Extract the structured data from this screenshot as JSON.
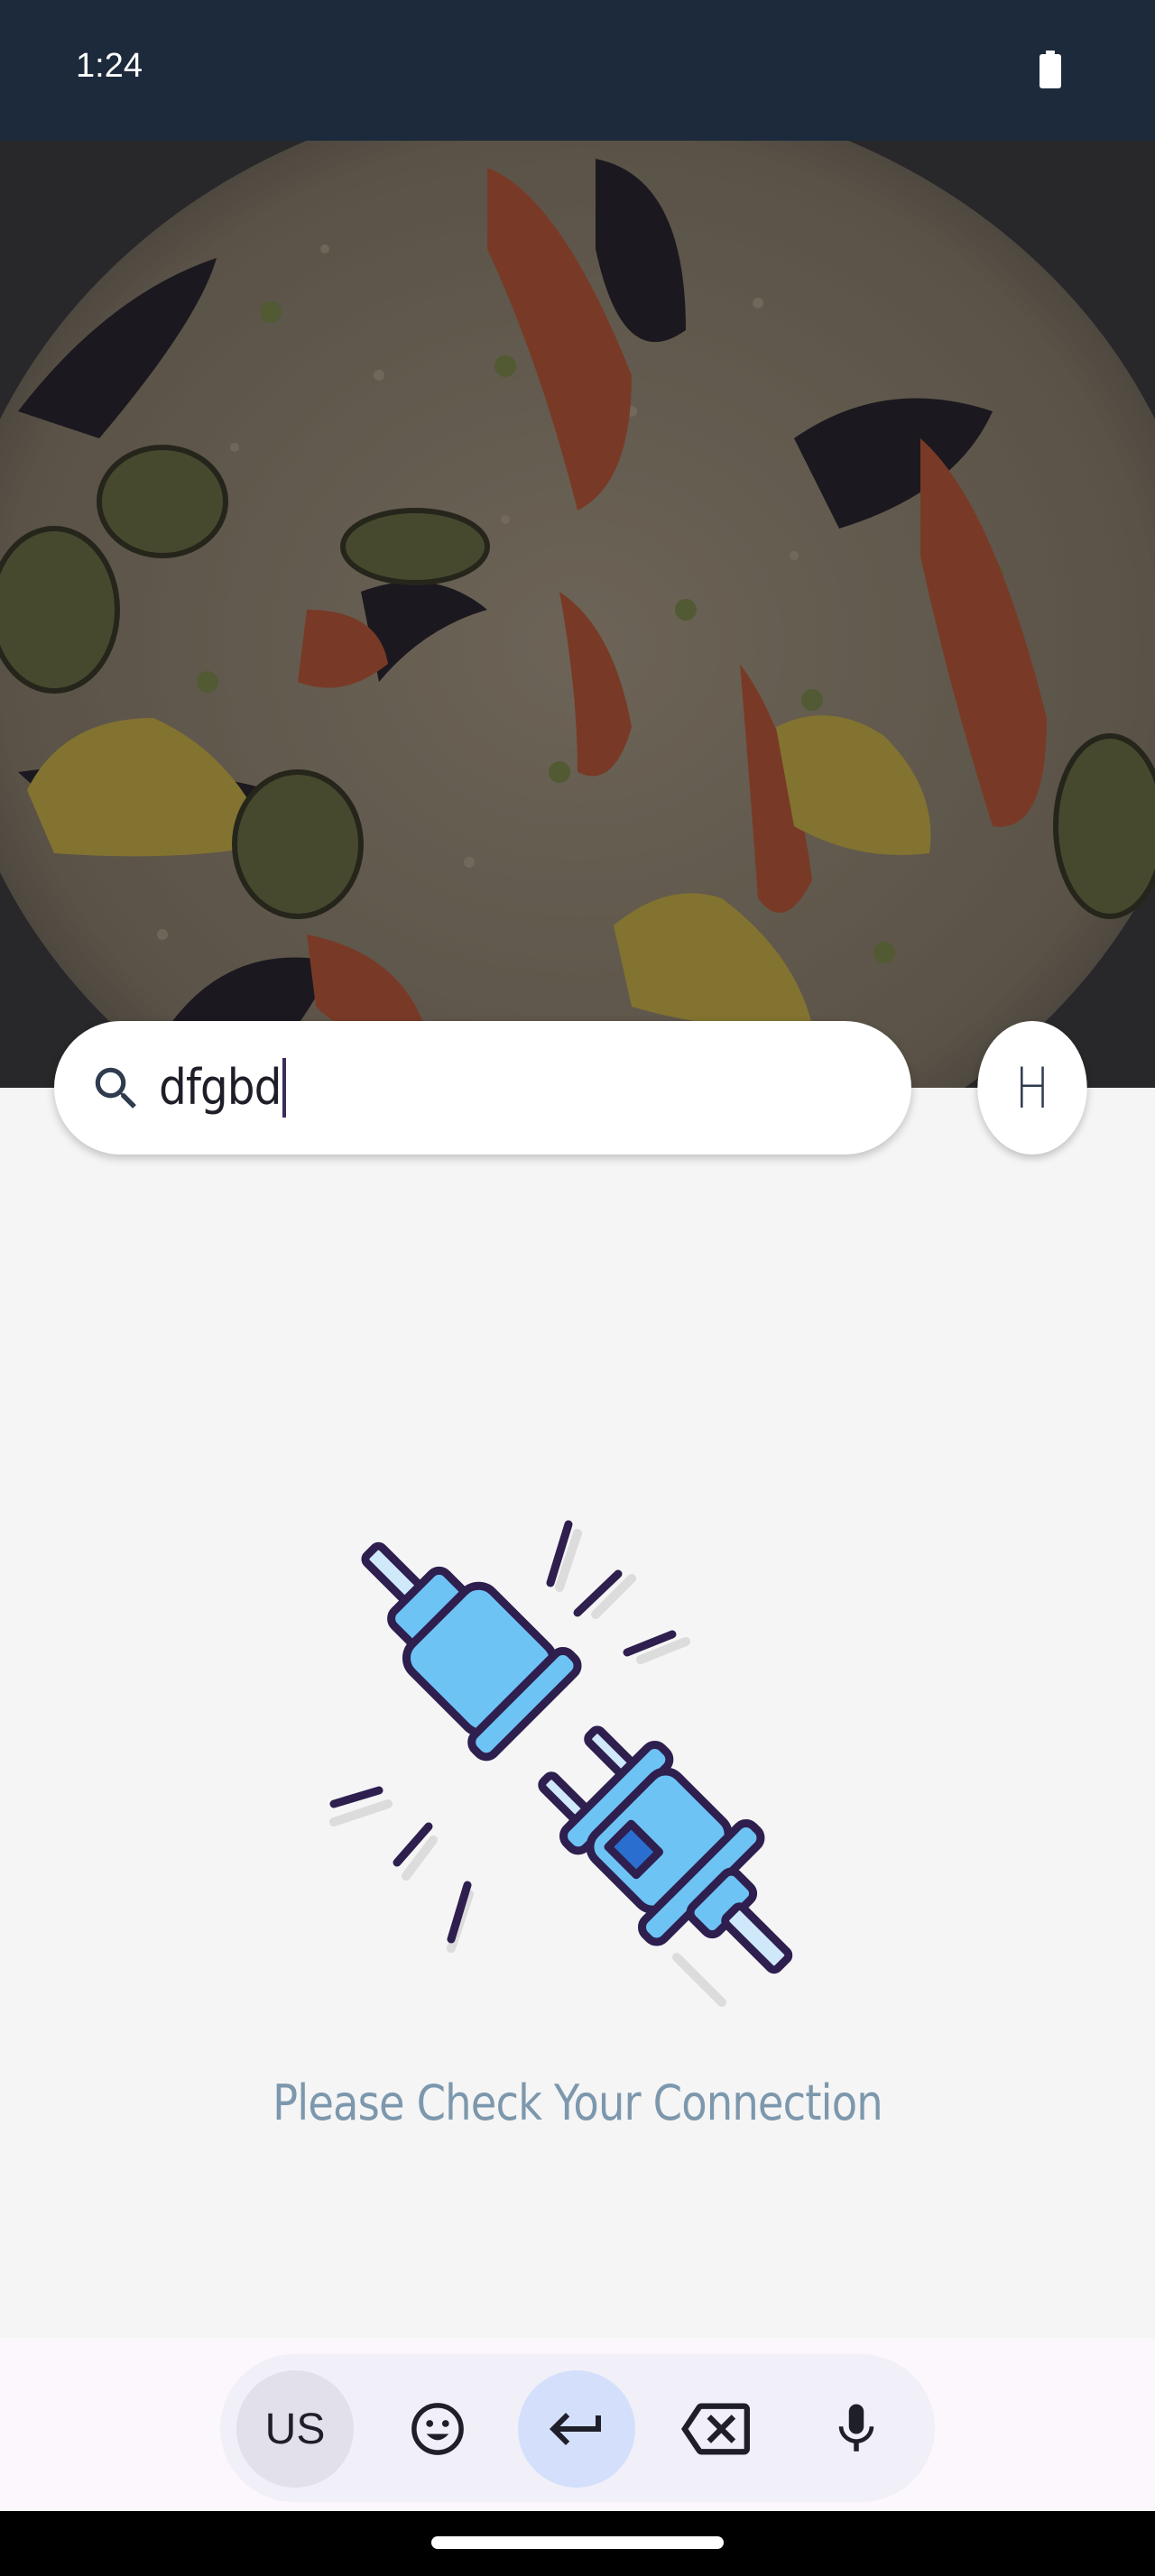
{
  "status_bar": {
    "time": "1:24"
  },
  "search": {
    "query": "dfgbd"
  },
  "avatar": {
    "initial": "H"
  },
  "offline": {
    "message": "Please Check Your Connection"
  },
  "keyboard": {
    "language_label": "US"
  },
  "colors": {
    "status_bar_bg": "#1d2a3c",
    "page_bg": "#f5f5f5",
    "message_text": "#7d98ad",
    "plug_blue": "#6ec3f5",
    "plug_outline": "#2e1f4f"
  }
}
